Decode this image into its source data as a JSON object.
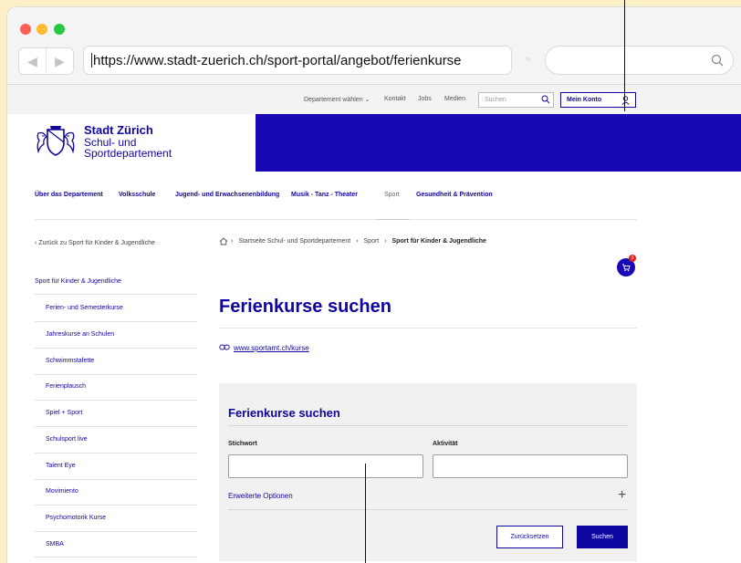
{
  "browser": {
    "url": "https://www.stadt-zuerich.ch/sport-portal/angebot/ferienkurse",
    "back_glyph": "◀",
    "forward_glyph": "▶"
  },
  "utility": {
    "departement": "Departement wählen ⌄",
    "kontakt": "Kontakt",
    "jobs": "Jobs",
    "medien": "Medien",
    "search_placeholder": "Suchen",
    "account": "Mein Konto"
  },
  "header": {
    "brand_line1": "Stadt Zürich",
    "brand_line2": "Schul- und",
    "brand_line3": "Sportdepartement"
  },
  "main_nav": [
    {
      "label": "Über das Departement"
    },
    {
      "label": "Volksschule"
    },
    {
      "label": "Jugend- und Erwachsenenbildung"
    },
    {
      "label": "Musik - Tanz - Theater"
    },
    {
      "label": "Sport",
      "active": true
    },
    {
      "label": "Gesundheit & Prävention"
    }
  ],
  "sidebar": {
    "back": "‹  Zurück zu Sport für Kinder & Jugendliche",
    "heading": "Sport für Kinder & Jugendliche",
    "items": [
      "Ferien- und Semesterkurse",
      "Jahreskurse an Schulen",
      "Schwimmstafette",
      "Ferienplausch",
      "Spiel + Sport",
      "Schulsport live",
      "Talent Eye",
      "Movimiento",
      "Psychomotorik Kurse",
      "SMBA"
    ]
  },
  "breadcrumb": {
    "sep": "›",
    "item1": "Startseite Schul- und Sportdepartement",
    "item2": "Sport",
    "current": "Sport für Kinder & Jugendliche"
  },
  "cart": {
    "count": "3"
  },
  "content": {
    "title": "Ferienkurse suchen",
    "link": "www.sportamt.ch/kurse"
  },
  "search_panel": {
    "title": "Ferienkurse suchen",
    "keyword_label": "Stichwort",
    "activity_label": "Aktivität",
    "advanced": "Erweiterte Optionen",
    "plus": "+",
    "reset": "Zurücksetzen",
    "submit": "Suchen"
  },
  "colors": {
    "brand_blue": "#0f05a0",
    "header_blue": "#1808b6",
    "cart_badge": "#e2231a",
    "page_background": "#fbefc6"
  }
}
